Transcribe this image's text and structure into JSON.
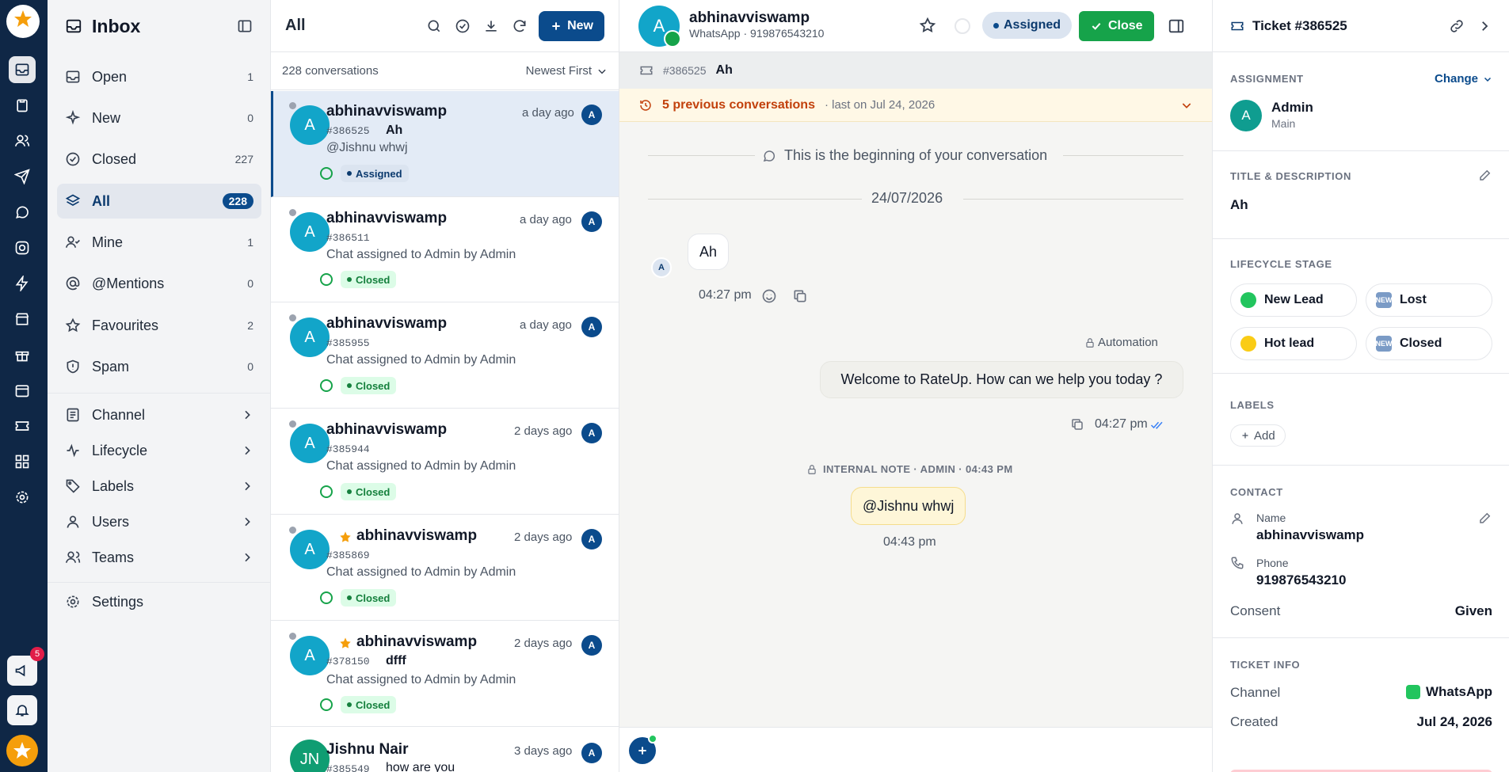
{
  "sidebar": {
    "title": "Inbox",
    "items": [
      {
        "label": "Open",
        "count": "1"
      },
      {
        "label": "New",
        "count": "0"
      },
      {
        "label": "Closed",
        "count": "227"
      },
      {
        "label": "All",
        "count": "228"
      },
      {
        "label": "Mine",
        "count": "1"
      },
      {
        "label": "@Mentions",
        "count": "0"
      },
      {
        "label": "Favourites",
        "count": "2"
      },
      {
        "label": "Spam",
        "count": "0"
      }
    ],
    "groups": [
      {
        "label": "Channel"
      },
      {
        "label": "Lifecycle"
      },
      {
        "label": "Labels"
      },
      {
        "label": "Users"
      },
      {
        "label": "Teams"
      }
    ],
    "settings_label": "Settings"
  },
  "rail": {
    "notification_badge": "5",
    "logo_text": "RateUp"
  },
  "list": {
    "title": "All",
    "new_label": "New",
    "count_text": "228 conversations",
    "sort_label": "Newest First",
    "items": [
      {
        "name": "abhinavviswamp",
        "time": "a day ago",
        "id": "#386525",
        "subject": "Ah",
        "preview": "@Jishnu whwj",
        "status": "Assigned",
        "assignee": "A",
        "starred": false,
        "avatar": "A"
      },
      {
        "name": "abhinavviswamp",
        "time": "a day ago",
        "id": "#386511",
        "subject": "",
        "preview": "Chat assigned to Admin by Admin",
        "status": "Closed",
        "assignee": "A",
        "starred": false,
        "avatar": "A"
      },
      {
        "name": "abhinavviswamp",
        "time": "a day ago",
        "id": "#385955",
        "subject": "",
        "preview": "Chat assigned to Admin by Admin",
        "status": "Closed",
        "assignee": "A",
        "starred": false,
        "avatar": "A"
      },
      {
        "name": "abhinavviswamp",
        "time": "2 days ago",
        "id": "#385944",
        "subject": "",
        "preview": "Chat assigned to Admin by Admin",
        "status": "Closed",
        "assignee": "A",
        "starred": false,
        "avatar": "A"
      },
      {
        "name": "abhinavviswamp",
        "time": "2 days ago",
        "id": "#385869",
        "subject": "",
        "preview": "Chat assigned to Admin by Admin",
        "status": "Closed",
        "assignee": "A",
        "starred": true,
        "avatar": "A"
      },
      {
        "name": "abhinavviswamp",
        "time": "2 days ago",
        "id": "#378150",
        "subject": "dfff",
        "preview": "Chat assigned to Admin by Admin",
        "status": "Closed",
        "assignee": "A",
        "starred": true,
        "avatar": "A"
      },
      {
        "name": "Jishnu Nair",
        "time": "3 days ago",
        "id": "#385549",
        "subject": "how are you",
        "preview": "",
        "status": "",
        "assignee": "A",
        "starred": false,
        "avatar": "JN"
      }
    ]
  },
  "chat": {
    "contact_name": "abhinavviswamp",
    "contact_sub": "WhatsApp · 919876543210",
    "avatar": "A",
    "status_pill": "Assigned",
    "close_label": "Close",
    "ticket_id": "#386525",
    "ticket_subject": "Ah",
    "prev_conversations": "5 previous conversations",
    "prev_last": "· last on Jul 24, 2026",
    "beginning_text": "This is the beginning of your conversation",
    "date_divider": "24/07/2026",
    "msg_in": {
      "avatar": "A",
      "text": "Ah",
      "time": "04:27 pm"
    },
    "automation_label": "Automation",
    "msg_out": {
      "text": "Welcome to RateUp. How can we help you today ?",
      "time": "04:27 pm"
    },
    "note_header": "INTERNAL NOTE · ADMIN · 04:43 PM",
    "note_text": "@Jishnu whwj",
    "note_time": "04:43 pm"
  },
  "details": {
    "ticket_title": "Ticket #386525",
    "assignment": {
      "heading": "ASSIGNMENT",
      "change_label": "Change",
      "avatar": "A",
      "name": "Admin",
      "team": "Main"
    },
    "title_desc": {
      "heading": "TITLE & DESCRIPTION",
      "value": "Ah"
    },
    "lifecycle": {
      "heading": "LIFECYCLE STAGE",
      "stages": [
        "New Lead",
        "Lost",
        "Hot lead",
        "Closed"
      ]
    },
    "labels": {
      "heading": "LABELS",
      "add_label": "Add"
    },
    "contact": {
      "heading": "CONTACT",
      "name_label": "Name",
      "name_value": "abhinavviswamp",
      "phone_label": "Phone",
      "phone_value": "919876543210",
      "consent_label": "Consent",
      "consent_value": "Given"
    },
    "ticket_info": {
      "heading": "TICKET INFO",
      "channel_label": "Channel",
      "channel_value": "WhatsApp",
      "created_label": "Created",
      "created_value": "Jul 24, 2026"
    }
  },
  "colors": {
    "primary": "#0b4b8c",
    "rail": "#0f2746",
    "whatsapp": "#16a34a",
    "warning_text": "#c2410c"
  }
}
